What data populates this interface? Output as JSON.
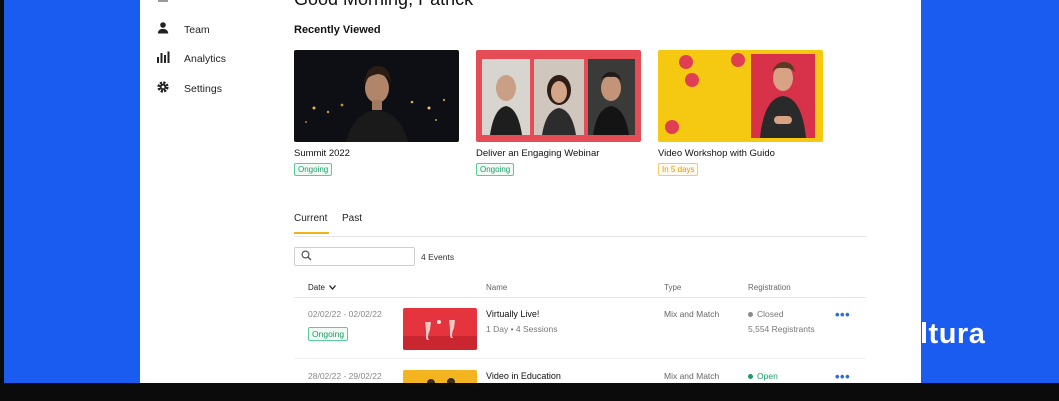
{
  "brand": {
    "text": "ltura"
  },
  "header": {
    "greeting": "Good Morning, Patrick"
  },
  "sidebar": {
    "items": [
      {
        "label": "Team",
        "icon": "person-icon"
      },
      {
        "label": "Analytics",
        "icon": "bar-chart-icon"
      },
      {
        "label": "Settings",
        "icon": "gear-icon"
      }
    ]
  },
  "recently_viewed": {
    "title": "Recently Viewed",
    "cards": [
      {
        "title": "Summit 2022",
        "badge": "Ongoing"
      },
      {
        "title": "Deliver an Engaging Webinar",
        "badge": "Ongoing"
      },
      {
        "title": "Video Workshop with Guido",
        "badge": "In 5 days"
      }
    ]
  },
  "tabs": {
    "items": [
      {
        "label": "Current"
      },
      {
        "label": "Past"
      }
    ]
  },
  "search": {
    "placeholder": "",
    "count_label": "4 Events"
  },
  "table": {
    "columns": [
      {
        "label": "Date"
      },
      {
        "label": "Name"
      },
      {
        "label": "Type"
      },
      {
        "label": "Registration"
      }
    ],
    "rows": [
      {
        "date": "02/02/22 - 02/02/22",
        "badge": "Ongoing",
        "name": "Virtually Live!",
        "subtitle": "1 Day • 4 Sessions",
        "type": "Mix and Match",
        "status": "Closed",
        "status_color": "#8a8a8a",
        "registrants": "5,554 Registrants",
        "more": "•••"
      },
      {
        "date": "28/02/22 - 29/02/22",
        "badge": "",
        "name": "Video in Education",
        "subtitle": "",
        "type": "Mix and Match",
        "status": "Open",
        "status_color": "#1b9c67",
        "registrants": "",
        "more": "•••"
      }
    ]
  },
  "colors": {
    "background_blue": "#1a5bf0",
    "accent_yellow": "#f2b418",
    "ongoing_green": "#1b9c67",
    "soon_amber": "#d79a16",
    "link_blue": "#2f6bd6"
  }
}
